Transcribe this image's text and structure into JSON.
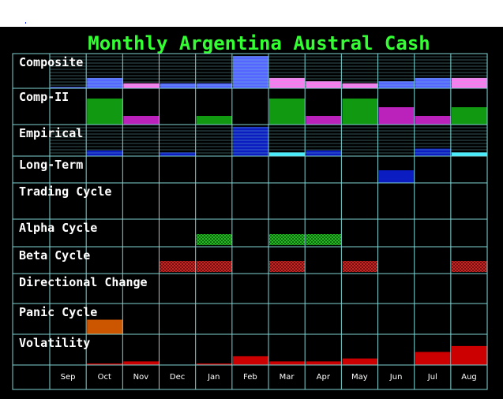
{
  "chart_data": {
    "type": "heatmap",
    "title": "Monthly Argentina Austral Cash",
    "months": [
      "Sep",
      "Oct",
      "Nov",
      "Dec",
      "Jan",
      "Feb",
      "Mar",
      "Apr",
      "May",
      "Jun",
      "Jul",
      "Aug"
    ],
    "grid": true,
    "rows": [
      {
        "label": "Composite",
        "style": "bars",
        "ylim": [
          0,
          8
        ],
        "bars": [
          {
            "month": "Sep",
            "value": 0.3,
            "color": "#5566ff"
          },
          {
            "month": "Oct",
            "value": 2.5,
            "color": "#5566ff"
          },
          {
            "month": "Nov",
            "value": 1.2,
            "color": "#ff77ee"
          },
          {
            "month": "Dec",
            "value": 1.2,
            "color": "#5566ff"
          },
          {
            "month": "Jan",
            "value": 1.2,
            "color": "#5566ff"
          },
          {
            "month": "Feb",
            "value": 7.8,
            "color": "#5566ff"
          },
          {
            "month": "Mar",
            "value": 2.5,
            "color": "#ff77ee"
          },
          {
            "month": "Apr",
            "value": 1.7,
            "color": "#ff77ee"
          },
          {
            "month": "May",
            "value": 1.2,
            "color": "#ff77ee"
          },
          {
            "month": "Jun",
            "value": 1.7,
            "color": "#5566ff"
          },
          {
            "month": "Jul",
            "value": 2.5,
            "color": "#5566ff"
          },
          {
            "month": "Aug",
            "value": 2.5,
            "color": "#ff77ee"
          }
        ]
      },
      {
        "label": "Comp-II",
        "style": "bars",
        "ylim": [
          0,
          4
        ],
        "bars": [
          {
            "month": "Oct",
            "value": 3.0,
            "color": "#119911"
          },
          {
            "month": "Nov",
            "value": 1.0,
            "color": "#bb22bb"
          },
          {
            "month": "Jan",
            "value": 1.0,
            "color": "#119911"
          },
          {
            "month": "Mar",
            "value": 3.0,
            "color": "#119911"
          },
          {
            "month": "Apr",
            "value": 1.0,
            "color": "#bb22bb"
          },
          {
            "month": "May",
            "value": 3.0,
            "color": "#119911"
          },
          {
            "month": "Jun",
            "value": 2.0,
            "color": "#bb22bb"
          },
          {
            "month": "Jul",
            "value": 1.0,
            "color": "#bb22bb"
          },
          {
            "month": "Aug",
            "value": 2.0,
            "color": "#119911"
          }
        ]
      },
      {
        "label": "Empirical",
        "style": "bars",
        "ylim": [
          0,
          8
        ],
        "bars": [
          {
            "month": "Oct",
            "value": 1.5,
            "color": "#0b1cc0"
          },
          {
            "month": "Dec",
            "value": 1.0,
            "color": "#0b1cc0"
          },
          {
            "month": "Feb",
            "value": 7.8,
            "color": "#0b1cc0"
          },
          {
            "month": "Mar",
            "value": 1.0,
            "color": "#44eeff"
          },
          {
            "month": "Apr",
            "value": 1.5,
            "color": "#0b1cc0"
          },
          {
            "month": "Jul",
            "value": 2.0,
            "color": "#0b1cc0"
          },
          {
            "month": "Aug",
            "value": 1.0,
            "color": "#44eeff"
          }
        ]
      },
      {
        "label": "Long-Term",
        "style": "bars",
        "ylim": [
          0,
          2
        ],
        "bars": [
          {
            "month": "Jun",
            "value": 1.0,
            "color": "#0b1cc0"
          }
        ]
      },
      {
        "label": "Trading Cycle",
        "style": "blocks",
        "active": [],
        "color": "#22bb22"
      },
      {
        "label": "Alpha Cycle",
        "style": "blocks",
        "active": [
          "Jan",
          "Mar",
          "Apr"
        ],
        "color": "#22bb22"
      },
      {
        "label": "Beta Cycle",
        "style": "blocks",
        "active": [
          "Dec",
          "Jan",
          "Mar",
          "May",
          "Aug"
        ],
        "color": "#cc2222"
      },
      {
        "label": "Directional Change",
        "style": "blocks",
        "active": [],
        "color": "#cc2222"
      },
      {
        "label": "Panic Cycle",
        "style": "bars",
        "ylim": [
          0,
          2
        ],
        "bars": [
          {
            "month": "Oct",
            "value": 1.0,
            "color": "#cc5500"
          }
        ]
      },
      {
        "label": "Volatility",
        "style": "bars",
        "ylim": [
          0,
          4
        ],
        "bars": [
          {
            "month": "Oct",
            "value": 0.2,
            "color": "#cc0000"
          },
          {
            "month": "Nov",
            "value": 0.5,
            "color": "#cc0000"
          },
          {
            "month": "Jan",
            "value": 0.2,
            "color": "#cc0000"
          },
          {
            "month": "Feb",
            "value": 1.2,
            "color": "#cc0000"
          },
          {
            "month": "Mar",
            "value": 0.5,
            "color": "#cc0000"
          },
          {
            "month": "Apr",
            "value": 0.5,
            "color": "#cc0000"
          },
          {
            "month": "May",
            "value": 0.9,
            "color": "#cc0000"
          },
          {
            "month": "Jul",
            "value": 1.8,
            "color": "#cc0000"
          },
          {
            "month": "Aug",
            "value": 2.6,
            "color": "#cc0000"
          }
        ]
      }
    ]
  },
  "colors": {
    "background": "#000000",
    "grid": "#7fd4d4",
    "title": "#33ff33",
    "label": "#ffffff"
  }
}
